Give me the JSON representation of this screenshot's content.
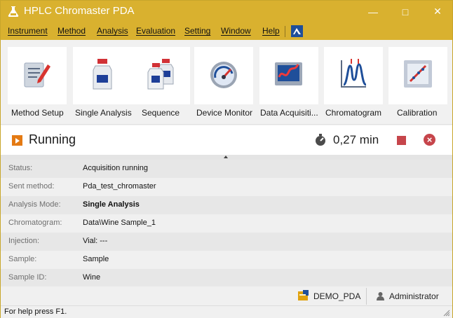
{
  "window": {
    "title": "HPLC Chromaster PDA",
    "controls": [
      "minimize",
      "maximize",
      "close"
    ]
  },
  "menu": [
    "Instrument",
    "Method",
    "Analysis",
    "Evaluation",
    "Setting",
    "Window",
    "Help"
  ],
  "toolbar": [
    {
      "label": "Method Setup",
      "icon": "method-setup-icon"
    },
    {
      "label": "Single Analysis",
      "icon": "single-analysis-icon"
    },
    {
      "label": "Sequence",
      "icon": "sequence-icon"
    },
    {
      "label": "Device Monitor",
      "icon": "device-monitor-icon"
    },
    {
      "label": "Data Acquisiti...",
      "icon": "data-acquisition-icon"
    },
    {
      "label": "Chromatogram",
      "icon": "chromatogram-icon"
    },
    {
      "label": "Calibration",
      "icon": "calibration-icon"
    }
  ],
  "run": {
    "state": "Running",
    "time": "0,27 min"
  },
  "details": [
    {
      "label": "Status:",
      "value": "Acquisition running"
    },
    {
      "label": "Sent method:",
      "value": "Pda_test_chromaster"
    },
    {
      "label": "Analysis Mode:",
      "value": "Single Analysis"
    },
    {
      "label": "Chromatogram:",
      "value": "Data\\Wine Sample_1"
    },
    {
      "label": "Injection:",
      "value": "Vial: ---"
    },
    {
      "label": "Sample:",
      "value": "Sample"
    },
    {
      "label": "Sample ID:",
      "value": "Wine"
    }
  ],
  "bottom": {
    "database": "DEMO_PDA",
    "user": "Administrator"
  },
  "status_bar": {
    "help": "For help press F1."
  },
  "colors": {
    "titlebar": "#d9b12f",
    "run_play": "#e47a13",
    "stop": "#c6454b"
  }
}
